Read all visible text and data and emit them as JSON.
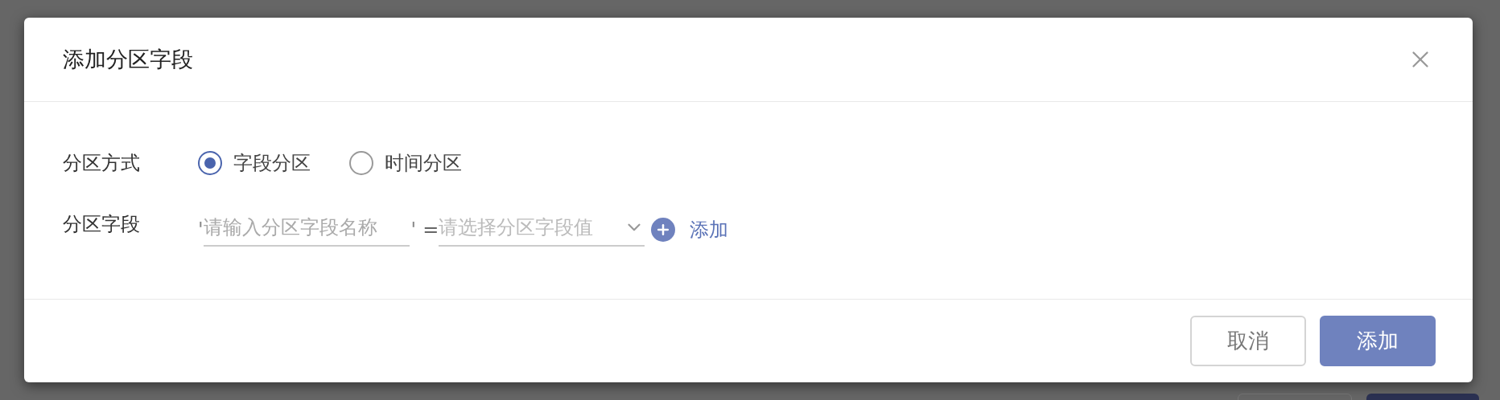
{
  "dialog": {
    "title": "添加分区字段"
  },
  "form": {
    "mode": {
      "label": "分区方式",
      "options": [
        {
          "label": "字段分区",
          "selected": true
        },
        {
          "label": "时间分区",
          "selected": false
        }
      ]
    },
    "field": {
      "label": "分区字段",
      "open_quote": "'",
      "name_placeholder": "请输入分区字段名称",
      "close_quote": "'",
      "equals": "=",
      "value_placeholder": "请选择分区字段值",
      "add_link": "添加"
    }
  },
  "footer": {
    "buttons": [
      {
        "label": "取消",
        "kind": "secondary"
      },
      {
        "label": "添加",
        "kind": "primary"
      }
    ]
  }
}
